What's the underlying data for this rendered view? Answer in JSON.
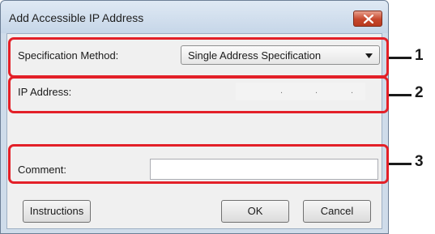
{
  "dialog": {
    "title": "Add Accessible IP Address",
    "close_icon": "close-x-icon"
  },
  "form": {
    "spec_method_label": "Specification Method:",
    "spec_method_value": "Single Address Specification",
    "ip_label": "IP Address:",
    "ip_value": ". . .",
    "comment_label": "Comment:",
    "comment_value": ""
  },
  "buttons": {
    "instructions": "Instructions",
    "ok": "OK",
    "cancel": "Cancel"
  },
  "callouts": [
    "1",
    "2",
    "3"
  ],
  "colors": {
    "highlight": "#e32028",
    "close_button": "#c6472c"
  }
}
